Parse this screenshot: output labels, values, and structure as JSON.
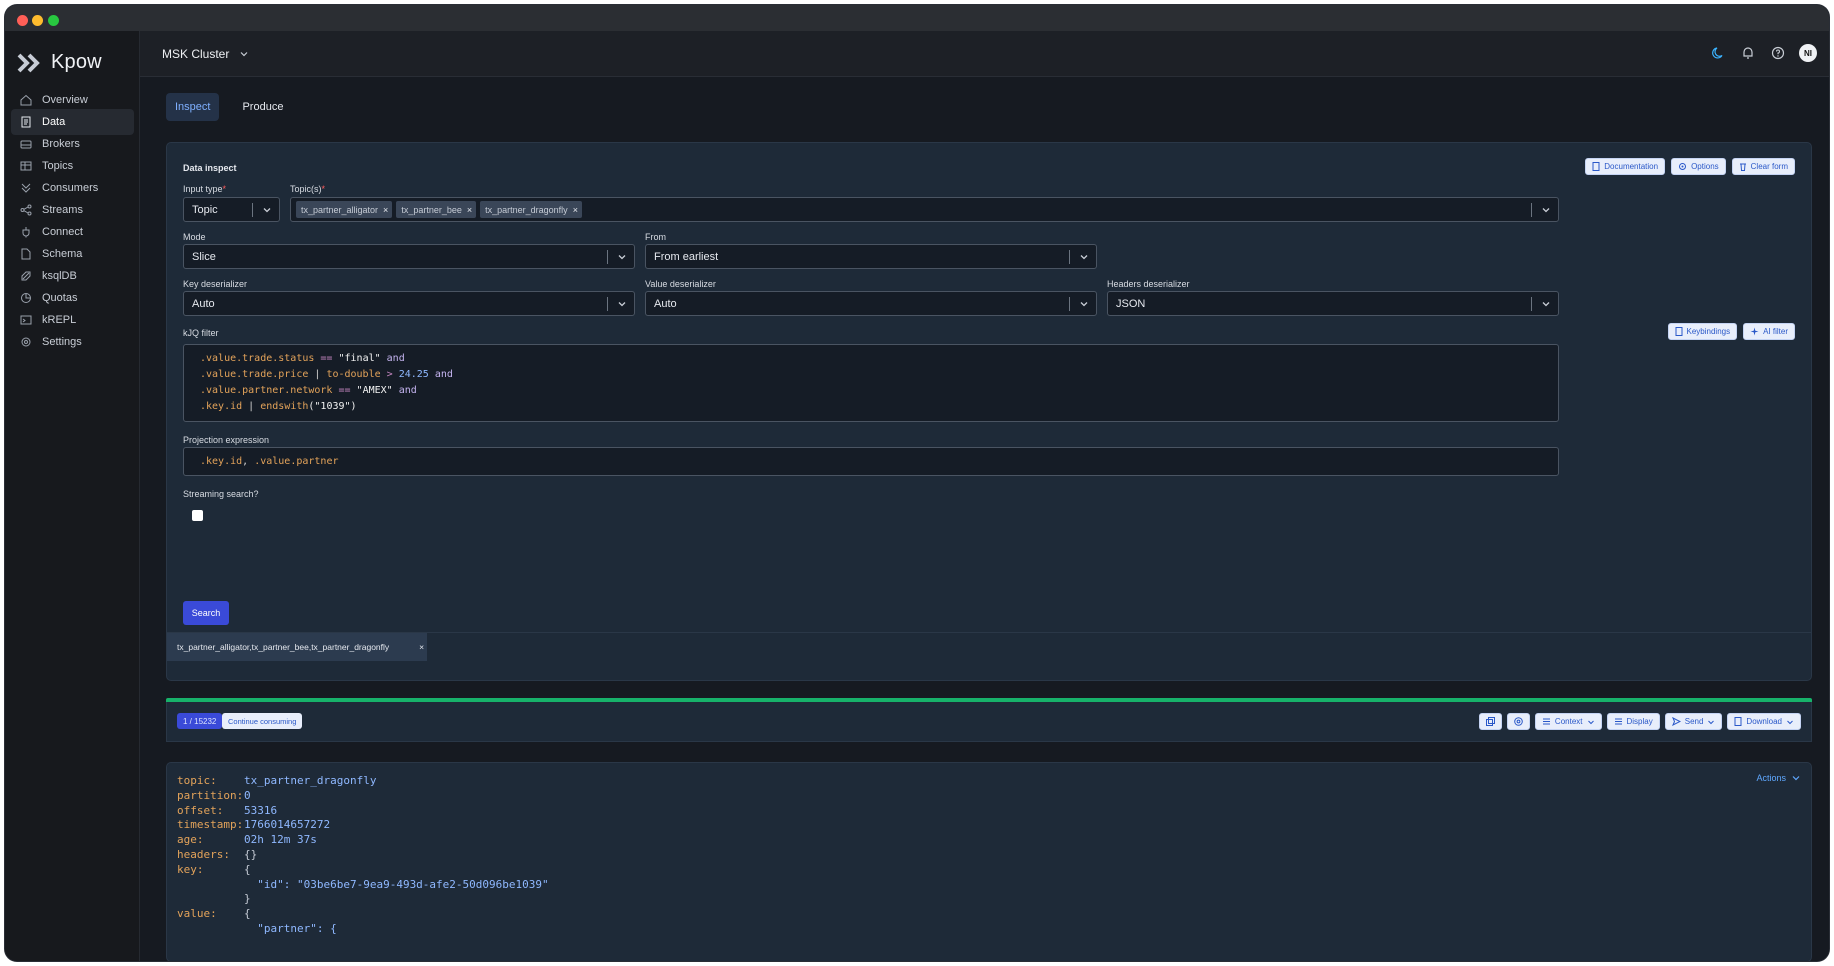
{
  "app": {
    "name": "Kpow"
  },
  "colors": {
    "accent": "#3a4ad8",
    "success": "#17b26a",
    "link": "#5fa8ff"
  },
  "sidebar": {
    "items": [
      {
        "label": "Overview",
        "icon": "home-icon"
      },
      {
        "label": "Data",
        "icon": "document-icon"
      },
      {
        "label": "Brokers",
        "icon": "server-icon"
      },
      {
        "label": "Topics",
        "icon": "table-icon"
      },
      {
        "label": "Consumers",
        "icon": "chevrons-icon"
      },
      {
        "label": "Streams",
        "icon": "share-icon"
      },
      {
        "label": "Connect",
        "icon": "plug-icon"
      },
      {
        "label": "Schema",
        "icon": "file-icon"
      },
      {
        "label": "ksqlDB",
        "icon": "rocket-icon"
      },
      {
        "label": "Quotas",
        "icon": "pie-icon"
      },
      {
        "label": "kREPL",
        "icon": "terminal-icon"
      },
      {
        "label": "Settings",
        "icon": "gear-icon"
      }
    ]
  },
  "topbar": {
    "cluster": "MSK Cluster",
    "avatar": "NI"
  },
  "tabs": {
    "inspect": "Inspect",
    "produce": "Produce"
  },
  "form": {
    "title": "Data inspect",
    "buttons": {
      "documentation": "Documentation",
      "options": "Options",
      "clear": "Clear form"
    },
    "input_type": {
      "label": "Input type",
      "value": "Topic"
    },
    "topics": {
      "label": "Topic(s)",
      "chips": [
        "tx_partner_alligator",
        "tx_partner_bee",
        "tx_partner_dragonfly"
      ]
    },
    "mode": {
      "label": "Mode",
      "value": "Slice"
    },
    "from": {
      "label": "From",
      "value": "From earliest"
    },
    "key_deser": {
      "label": "Key deserializer",
      "value": "Auto"
    },
    "value_deser": {
      "label": "Value deserializer",
      "value": "Auto"
    },
    "headers_deser": {
      "label": "Headers deserializer",
      "value": "JSON"
    },
    "kjq": {
      "label": "kJQ filter",
      "keybindings": "Keybindings",
      "ai": "AI filter",
      "lines": [
        [
          [
            ".value.trade.status",
            "k"
          ],
          [
            " == ",
            "op"
          ],
          [
            "\"final\"",
            "s"
          ],
          [
            " and",
            "w"
          ]
        ],
        [
          [
            ".value.trade.price",
            "k"
          ],
          [
            " | ",
            "p"
          ],
          [
            "to-double",
            "f"
          ],
          [
            " > ",
            "op"
          ],
          [
            "24.25",
            "n"
          ],
          [
            " and",
            "w"
          ]
        ],
        [
          [
            ".value.partner.network",
            "k"
          ],
          [
            " == ",
            "op"
          ],
          [
            "\"AMEX\"",
            "s"
          ],
          [
            " and",
            "w"
          ]
        ],
        [
          [
            ".key.id",
            "k"
          ],
          [
            " | ",
            "p"
          ],
          [
            "endswith",
            "f"
          ],
          [
            "(\"1039\")",
            "s"
          ]
        ]
      ]
    },
    "projection": {
      "label": "Projection expression",
      "parts": [
        [
          ".key.id",
          "k"
        ],
        [
          ", ",
          "p"
        ],
        [
          ".value.partner",
          "k"
        ]
      ]
    },
    "streaming": {
      "label": "Streaming search?"
    },
    "search": "Search"
  },
  "result_tab": {
    "label": "tx_partner_alligator,tx_partner_bee,tx_partner_dragonfly",
    "close": "×"
  },
  "toolbar": {
    "count": "1 / 15232",
    "continue": "Continue consuming",
    "context": "Context",
    "display": "Display",
    "send": "Send",
    "download": "Download"
  },
  "record": {
    "actions": "Actions",
    "rows": [
      {
        "k": "topic:",
        "v": "tx_partner_dragonfly",
        "cls": ""
      },
      {
        "k": "partition:",
        "v": "0",
        "cls": ""
      },
      {
        "k": "offset:",
        "v": "53316",
        "cls": ""
      },
      {
        "k": "timestamp:",
        "v": "1766014657272",
        "cls": ""
      },
      {
        "k": "age:",
        "v": "02h 12m 37s",
        "cls": ""
      },
      {
        "k": "headers:",
        "v": "{}",
        "cls": "p"
      },
      {
        "k": "key:",
        "v": "{",
        "cls": "p"
      },
      {
        "k": "",
        "v": "  \"id\": \"03be6be7-9ea9-493d-afe2-50d096be1039\"",
        "cls": ""
      },
      {
        "k": "",
        "v": "}",
        "cls": "p"
      },
      {
        "k": "value:",
        "v": "{",
        "cls": "p"
      },
      {
        "k": "",
        "v": "  \"partner\": {",
        "cls": ""
      }
    ]
  }
}
